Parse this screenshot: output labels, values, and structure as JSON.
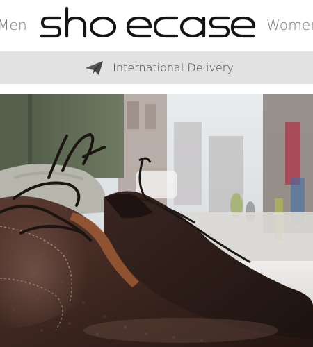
{
  "header": {
    "nav_left": "Men",
    "nav_right": "Women",
    "logo_text": "shoecase"
  },
  "delivery": {
    "icon": "paper-plane-icon",
    "text": "International Delivery"
  },
  "hero": {
    "image": "photo of leather derby shoes on a shop window ledge with blurred street background"
  },
  "colors": {
    "nav_text": "#7a7a7a",
    "logo": "#141414",
    "delivery_bar": "#e2e2e2",
    "delivery_text": "#444444"
  }
}
